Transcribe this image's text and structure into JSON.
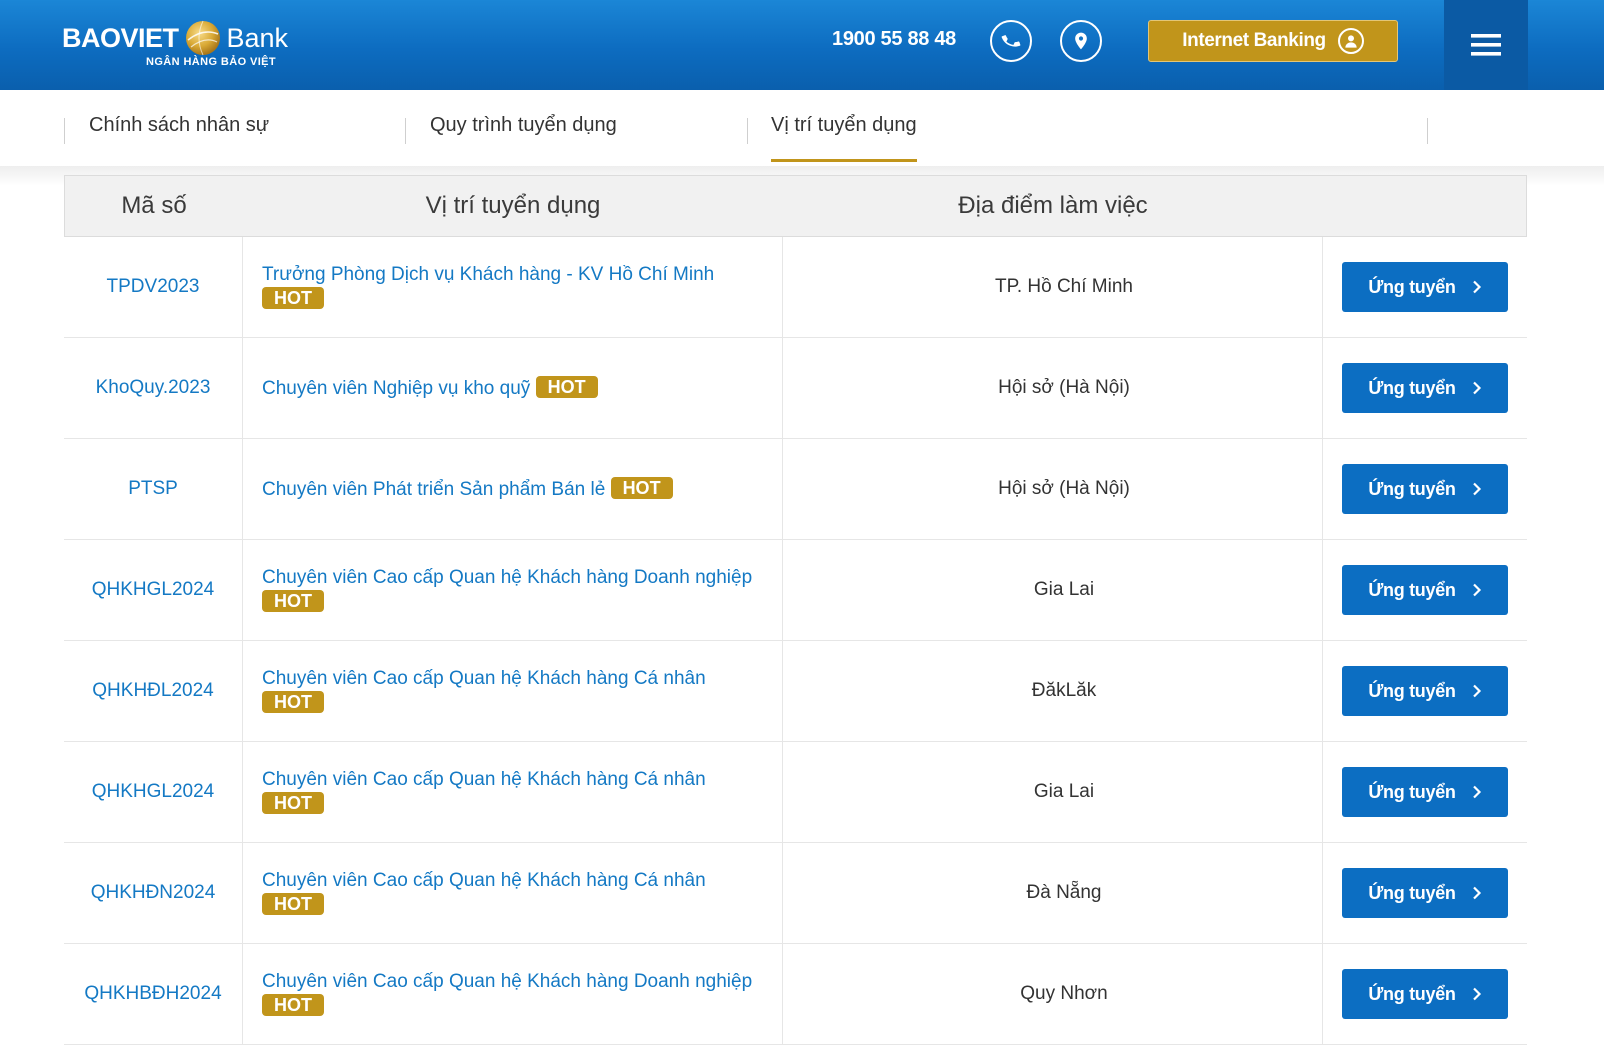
{
  "header": {
    "logo_brand": "BAOVIET",
    "logo_bank": "Bank",
    "logo_subtitle": "NGÂN HÀNG BẢO VIỆT",
    "hotline": "1900 55 88 48",
    "internet_banking_label": "Internet Banking",
    "phone_icon": "phone-icon",
    "location_icon": "location-pin-icon",
    "menu_icon": "hamburger-menu-icon",
    "brand_color": "#0d6cc0",
    "accent_color": "#c1951b"
  },
  "subnav": {
    "tabs": [
      {
        "label": "Chính sách nhân sự",
        "active": false
      },
      {
        "label": "Quy trình tuyển dụng",
        "active": false
      },
      {
        "label": "Vị trí tuyển dụng",
        "active": true
      }
    ]
  },
  "table": {
    "columns": [
      "Mã số",
      "Vị trí tuyển dụng",
      "Địa điểm làm việc",
      ""
    ],
    "hot_label": "HOT",
    "apply_label": "Ứng tuyển",
    "rows": [
      {
        "code": "TPDV2023",
        "title": "Trưởng Phòng Dịch vụ Khách hàng - KV Hồ Chí Minh",
        "hot": true,
        "location": "TP. Hồ Chí Minh"
      },
      {
        "code": "KhoQuy.2023",
        "title": "Chuyên viên Nghiệp vụ kho quỹ",
        "hot": true,
        "location": "Hội sở (Hà Nội)"
      },
      {
        "code": "PTSP",
        "title": "Chuyên viên Phát triển Sản phẩm Bán lẻ",
        "hot": true,
        "location": "Hội sở (Hà Nội)"
      },
      {
        "code": "QHKHGL2024",
        "title": "Chuyên viên Cao cấp Quan hệ Khách hàng Doanh nghiệp",
        "hot": true,
        "location": "Gia Lai"
      },
      {
        "code": "QHKHĐL2024",
        "title": "Chuyên viên Cao cấp Quan hệ Khách hàng Cá nhân",
        "hot": true,
        "location": "ĐăkLăk"
      },
      {
        "code": "QHKHGL2024",
        "title": "Chuyên viên Cao cấp Quan hệ Khách hàng Cá nhân",
        "hot": true,
        "location": "Gia Lai"
      },
      {
        "code": "QHKHĐN2024",
        "title": "Chuyên viên Cao cấp Quan hệ Khách hàng Cá nhân",
        "hot": true,
        "location": "Đà Nẵng"
      },
      {
        "code": "QHKHBĐH2024",
        "title": "Chuyên viên Cao cấp Quan hệ Khách hàng Doanh nghiệp",
        "hot": true,
        "location": "Quy Nhơn"
      }
    ]
  }
}
